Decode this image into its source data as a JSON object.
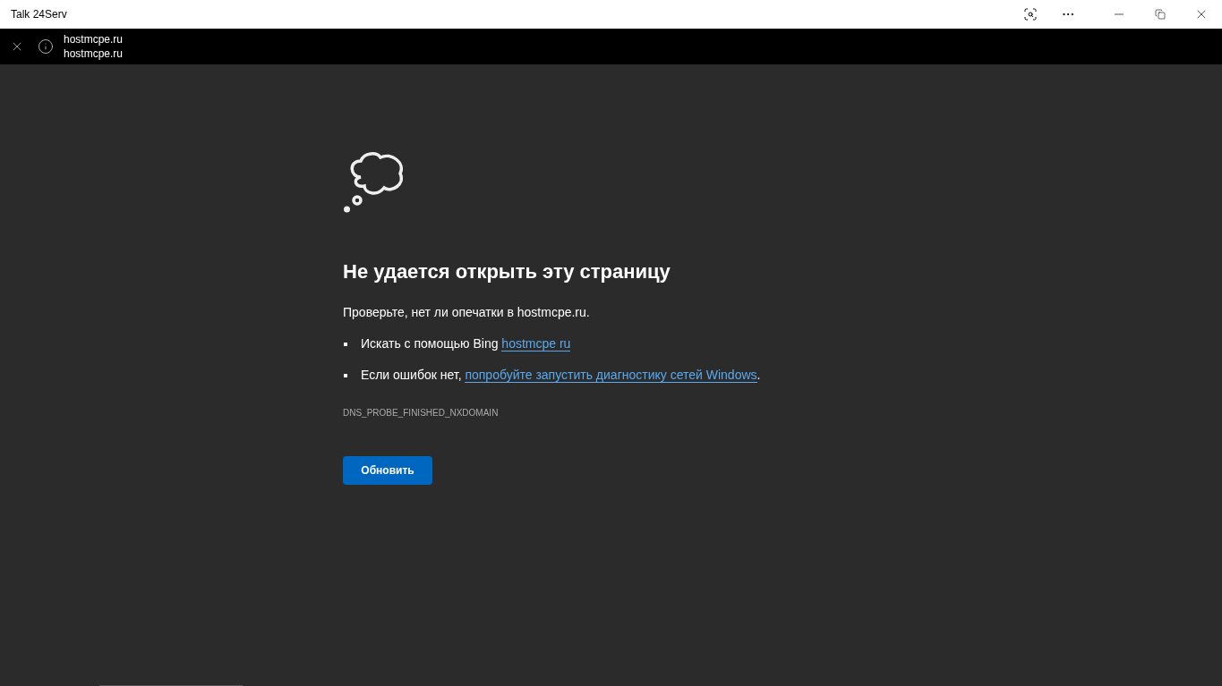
{
  "window": {
    "title": "Talk 24Serv"
  },
  "address_bar": {
    "title": "hostmcpe.ru",
    "url": "hostmcpe.ru"
  },
  "error": {
    "heading": "Не удается открыть эту страницу",
    "message": "Проверьте, нет ли опечатки в hostmcpe.ru.",
    "suggestions": [
      {
        "text": "Искать с помощью Bing ",
        "link": "hostmcpe ru"
      },
      {
        "text": "Если ошибок нет, ",
        "link": "попробуйте запустить диагностику сетей Windows",
        "suffix": "."
      }
    ],
    "code": "DNS_PROBE_FINISHED_NXDOMAIN",
    "button": "Обновить"
  }
}
